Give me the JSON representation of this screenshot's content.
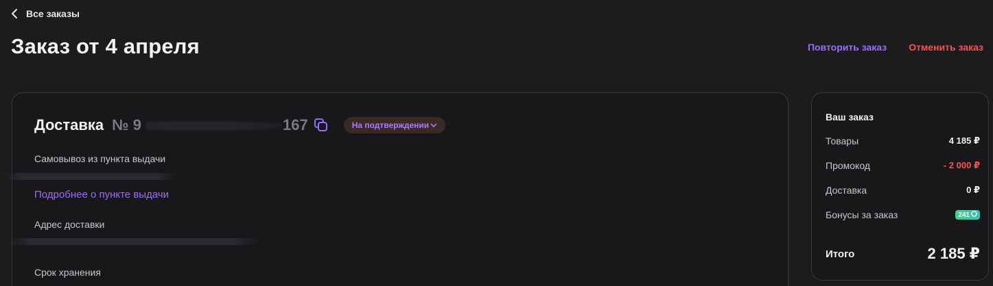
{
  "header": {
    "back_label": "Все заказы",
    "title": "Заказ от 4 апреля",
    "repeat_label": "Повторить заказ",
    "cancel_label": "Отменить заказ"
  },
  "delivery": {
    "title": "Доставка",
    "number_prefix": "№ 9",
    "number_suffix": "167",
    "status": "На подтверждении",
    "pickup_label": "Самовывоз из пункта выдачи",
    "details_link": "Подробнее о пункте выдачи",
    "address_label": "Адрес доставки",
    "storage_label": "Срок хранения"
  },
  "summary": {
    "title": "Ваш заказ",
    "rows": [
      {
        "label": "Товары",
        "value": "4 185 ₽"
      },
      {
        "label": "Промокод",
        "value": "- 2 000 ₽"
      },
      {
        "label": "Доставка",
        "value": "0 ₽"
      },
      {
        "label": "Бонусы за заказ",
        "value": "241"
      }
    ],
    "total_label": "Итого",
    "total_value": "2 185 ₽"
  },
  "colors": {
    "accent": "#9b6bff",
    "danger": "#ff4f4f",
    "background": "#1c1c1e",
    "bonus": "#3ad28a"
  }
}
